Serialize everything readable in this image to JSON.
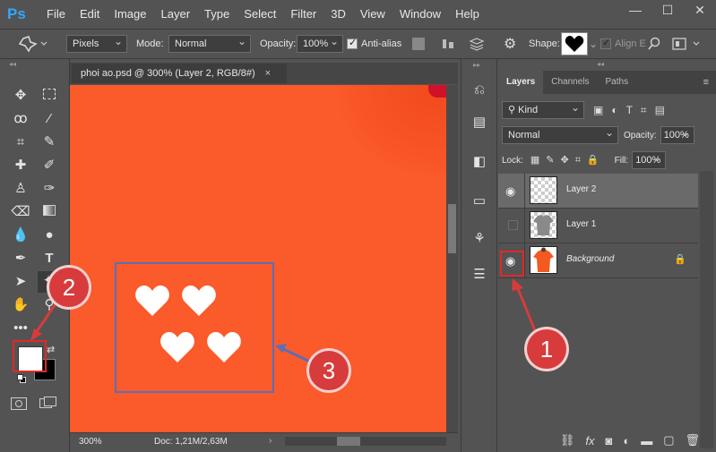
{
  "app": {
    "logo": "Ps"
  },
  "menu": [
    "File",
    "Edit",
    "Image",
    "Layer",
    "Type",
    "Select",
    "Filter",
    "3D",
    "View",
    "Window",
    "Help"
  ],
  "window_controls": {
    "minimize": "—",
    "maximize": "☐",
    "close": "✕"
  },
  "options": {
    "tool_mode": "Pixels",
    "mode_label": "Mode:",
    "mode_value": "Normal",
    "opacity_label": "Opacity:",
    "opacity_value": "100%",
    "antialias_label": "Anti-alias",
    "antialias_checked": true,
    "shape_label": "Shape:",
    "align_edges_label": "Align E"
  },
  "document": {
    "tab_title": "phoi ao.psd @ 300% (Layer 2, RGB/8#)",
    "tab_close": "×",
    "zoom": "300%",
    "doc_info": "Doc: 1,21M/2,63M",
    "canvas_color": "#fb5a2a"
  },
  "layers_panel": {
    "tabs": [
      "Layers",
      "Channels",
      "Paths"
    ],
    "active_tab": "Layers",
    "filter_kind": "Kind",
    "blend_mode": "Normal",
    "opacity_label": "Opacity:",
    "opacity_value": "100%",
    "lock_label": "Lock:",
    "fill_label": "Fill:",
    "fill_value": "100%",
    "layers": [
      {
        "name": "Layer 2",
        "visible": true,
        "selected": true
      },
      {
        "name": "Layer 1",
        "visible": false,
        "selected": false
      },
      {
        "name": "Background",
        "visible": true,
        "selected": false,
        "locked": true
      }
    ]
  },
  "toolbox": {
    "foreground_color": "#ffffff",
    "background_color": "#000000"
  },
  "callouts": {
    "one": "1",
    "two": "2",
    "three": "3"
  },
  "colors": {
    "accent_red": "#d83b3b",
    "selection_blue": "#5b6fb8",
    "ps_blue": "#31a8ff"
  }
}
